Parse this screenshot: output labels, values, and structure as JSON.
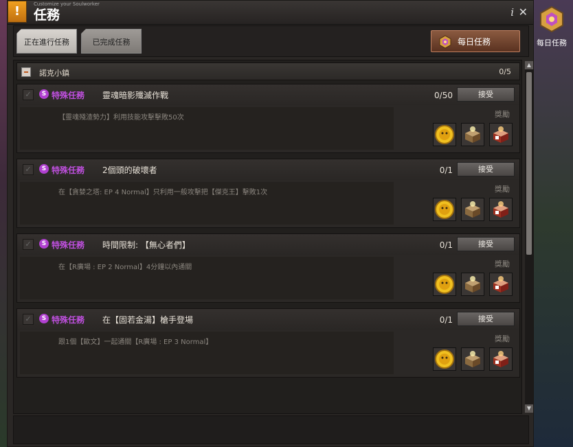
{
  "window": {
    "title": "任務",
    "subtitle": "Customize your Soulworker",
    "info_label": "i",
    "close_label": "✕"
  },
  "tabs": [
    {
      "label": "正在進行任務"
    },
    {
      "label": "已完成任務"
    }
  ],
  "daily_button": {
    "label": "每日任務"
  },
  "side_daily": {
    "label": "每日任務"
  },
  "group": {
    "name": "諾克小鎮",
    "count": "0/5"
  },
  "quests": [
    {
      "type": "特殊任務",
      "type_icon": "S",
      "title": "靈魂暗影殲滅作戰",
      "progress": "0/50",
      "accept": "接受",
      "description": "【靈魂殘渣勢力】利用技能攻擊擊敗50次",
      "reward_label": "獎勵",
      "rewards": [
        "gold-coin-icon",
        "treasure-box-icon",
        "red-box-icon"
      ]
    },
    {
      "type": "特殊任務",
      "type_icon": "S",
      "title": "2個頭的破壞者",
      "progress": "0/1",
      "accept": "接受",
      "description": "在【貪婪之塔: EP 4 Normal】只利用一般攻擊把【傑克王】擊敗1次",
      "reward_label": "獎勵",
      "rewards": [
        "gold-coin-icon",
        "treasure-box-icon",
        "red-box-icon"
      ]
    },
    {
      "type": "特殊任務",
      "type_icon": "S",
      "title": "時間限制: 【無心者們】",
      "progress": "0/1",
      "accept": "接受",
      "description": "在【R廣場 : EP 2 Normal】4分鐘以內通關",
      "reward_label": "獎勵",
      "rewards": [
        "gold-coin-icon",
        "treasure-box-icon",
        "red-box-icon"
      ]
    },
    {
      "type": "特殊任務",
      "type_icon": "S",
      "title": "在【固若金湯】槍手登場",
      "progress": "0/1",
      "accept": "接受",
      "description": "跟1個【歐文】一起通關【R廣場 : EP 3 Normal】",
      "reward_label": "獎勵",
      "rewards": [
        "gold-coin-icon",
        "treasure-box-icon",
        "red-box-icon"
      ]
    }
  ],
  "colors": {
    "quest_type": "#c050e0",
    "daily_button": "#8a5a40",
    "badge": "#f0a020"
  }
}
